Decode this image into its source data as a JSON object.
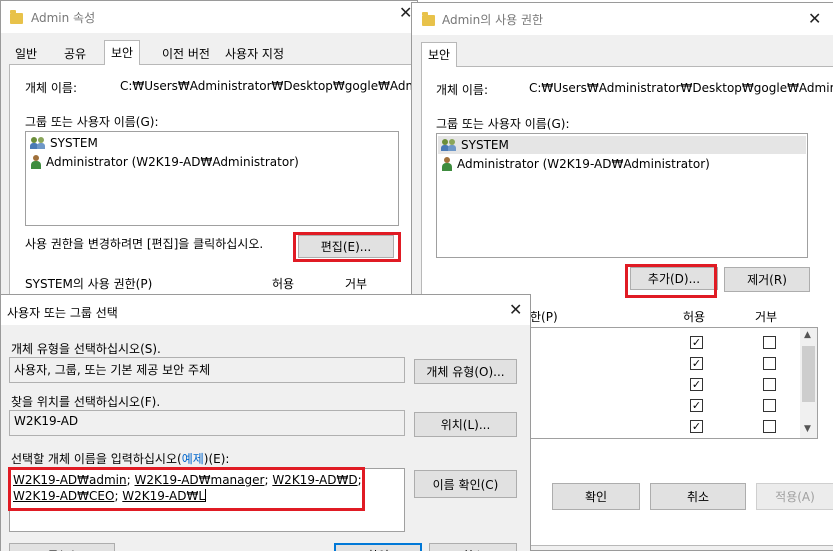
{
  "props_window": {
    "title": "Admin 속성",
    "tabs": [
      "일반",
      "공유",
      "보안",
      "이전 버전",
      "사용자 지정"
    ],
    "object_name_label": "개체 이름:",
    "object_name_value": "C:₩Users₩Administrator₩Desktop₩gogle₩Admin",
    "group_label": "그룹 또는 사용자 이름(G):",
    "principals": [
      "SYSTEM",
      "Administrator (W2K19-AD₩Administrator)"
    ],
    "edit_hint": "사용 권한을 변경하려면 [편집]을 클릭하십시오.",
    "edit_button": "편집(E)...",
    "perm_label": "SYSTEM의 사용 권한(P)",
    "allow_col": "허용",
    "deny_col": "거부"
  },
  "perm_window": {
    "title": "Admin의 사용 권한",
    "tab": "보안",
    "object_name_label": "개체 이름:",
    "object_name_value": "C:₩Users₩Administrator₩Desktop₩gogle₩Admin",
    "group_label": "그룹 또는 사용자 이름(G):",
    "principals": [
      "SYSTEM",
      "Administrator (W2K19-AD₩Administrator)"
    ],
    "add_button": "추가(D)...",
    "remove_button": "제거(R)",
    "perm_label_tail": "한(P)",
    "allow_col": "허용",
    "deny_col": "거부",
    "ok_button": "확인",
    "cancel_button": "취소",
    "apply_button": "적용(A)"
  },
  "select_dialog": {
    "title": "사용자 또는 그룹 선택",
    "type_label": "개체 유형을 선택하십시오(S).",
    "type_value": "사용자, 그룹, 또는 기본 제공 보안 주체",
    "type_button": "개체 유형(O)...",
    "location_label": "찾을 위치를 선택하십시오(F).",
    "location_value": "W2K19-AD",
    "location_button": "위치(L)...",
    "names_label_pre": "선택할 개체 이름을 입력하십시오(",
    "names_label_link": "예제",
    "names_label_post": ")(E):",
    "names": [
      "W2K19-AD₩admin",
      "W2K19-AD₩manager",
      "W2K19-AD₩D",
      "W2K19-AD₩CEO",
      "W2K19-AD₩L"
    ],
    "check_names_button": "이름 확인(C)",
    "advanced_button": "고급(A)...",
    "ok_button": "확인",
    "cancel_button": "취소"
  },
  "colors": {
    "highlight_red": "#e01b24",
    "link_blue": "#0066cc",
    "folder_yellow": "#e8c24a"
  }
}
